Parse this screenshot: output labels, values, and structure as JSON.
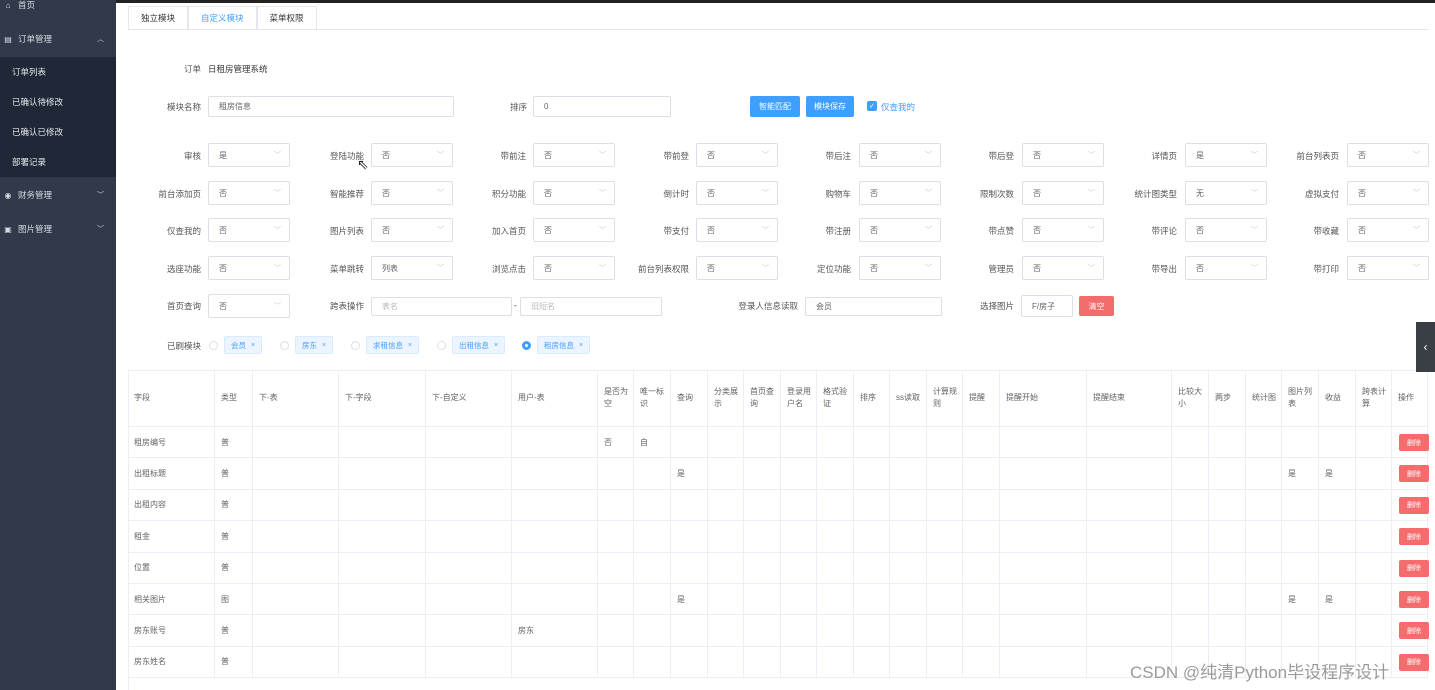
{
  "sidebar": {
    "items": [
      {
        "icon": "home-icon",
        "label": "首页"
      },
      {
        "icon": "order-icon",
        "label": "订单管理"
      },
      {
        "label": "订单列表"
      },
      {
        "label": "已确认待修改"
      },
      {
        "label": "已确认已修改"
      },
      {
        "label": "部署记录"
      },
      {
        "icon": "finance-icon",
        "label": "财务管理"
      },
      {
        "icon": "image-icon",
        "label": "图片管理"
      }
    ]
  },
  "tabs": [
    "独立模块",
    "自定义模块",
    "菜单权限"
  ],
  "order": {
    "label": "订单",
    "value": "日租房管理系统"
  },
  "module": {
    "name_label": "模块名称",
    "name_value": "租房信息",
    "sort_label": "排序",
    "sort_value": "0",
    "smart_match": "智能匹配",
    "save": "模块保存",
    "only_mine": "仅查我的"
  },
  "options": [
    {
      "label": "审核",
      "value": "是"
    },
    {
      "label": "登陆功能",
      "value": "否"
    },
    {
      "label": "带前注",
      "value": "否"
    },
    {
      "label": "带前登",
      "value": "否"
    },
    {
      "label": "带后注",
      "value": "否"
    },
    {
      "label": "带后登",
      "value": "否"
    },
    {
      "label": "详情页",
      "value": "是"
    },
    {
      "label": "前台列表页",
      "value": "否"
    },
    {
      "label": "前台添加页",
      "value": "否"
    },
    {
      "label": "智能推荐",
      "value": "否"
    },
    {
      "label": "积分功能",
      "value": "否"
    },
    {
      "label": "倒计时",
      "value": "否"
    },
    {
      "label": "购物车",
      "value": "否"
    },
    {
      "label": "限制次数",
      "value": "否"
    },
    {
      "label": "统计图类型",
      "value": "无"
    },
    {
      "label": "虚拟支付",
      "value": "否"
    },
    {
      "label": "仅查我的",
      "value": "否"
    },
    {
      "label": "图片列表",
      "value": "否"
    },
    {
      "label": "加入首页",
      "value": "否"
    },
    {
      "label": "带支付",
      "value": "否"
    },
    {
      "label": "带注册",
      "value": "否"
    },
    {
      "label": "带点赞",
      "value": "否"
    },
    {
      "label": "带评论",
      "value": "否"
    },
    {
      "label": "带收藏",
      "value": "否"
    },
    {
      "label": "选座功能",
      "value": "否"
    },
    {
      "label": "菜单跳转",
      "value": "列表"
    },
    {
      "label": "浏览点击",
      "value": "否"
    },
    {
      "label": "前台列表权限",
      "value": "否"
    },
    {
      "label": "定位功能",
      "value": "否"
    },
    {
      "label": "管理员",
      "value": "否"
    },
    {
      "label": "带导出",
      "value": "否"
    },
    {
      "label": "带打印",
      "value": "否"
    },
    {
      "label": "首页查询",
      "value": "否"
    }
  ],
  "cross": {
    "label": "跨表操作",
    "ph1": "表名",
    "sep": "-",
    "ph2": "旧短名"
  },
  "login_info": {
    "label": "登录人信息读取",
    "value": "会员"
  },
  "image_pick": {
    "label": "选择图片",
    "value": "F/房子",
    "clear": "清空"
  },
  "modules": {
    "label": "已刷模块",
    "tags": [
      "会员",
      "房东",
      "求租信息",
      "出租信息",
      "租房信息"
    ],
    "selected": 4
  },
  "table": {
    "headers": [
      "字段",
      "类型",
      "下-表",
      "下-字段",
      "下-自定义",
      "用户-表",
      "是否为空",
      "唯一标识",
      "查询",
      "分类展示",
      "首页查询",
      "登录用户名",
      "格式验证",
      "排序",
      "ss读取",
      "计算规则",
      "提醒",
      "提醒开始",
      "提醒结束",
      "比较大小",
      "两步",
      "统计图",
      "图片列表",
      "收益",
      "跨表计算",
      "操作"
    ],
    "delete_label": "删除",
    "rows": [
      {
        "field": "租房编号",
        "type": "普",
        "user_table": "",
        "nullable": "否",
        "unique": "自",
        "query": "",
        "img_list": "",
        "revenue": ""
      },
      {
        "field": "出租标题",
        "type": "普",
        "user_table": "",
        "nullable": "",
        "unique": "",
        "query": "是",
        "img_list": "是",
        "revenue": "是"
      },
      {
        "field": "出租内容",
        "type": "普",
        "user_table": "",
        "nullable": "",
        "unique": "",
        "query": "",
        "img_list": "",
        "revenue": ""
      },
      {
        "field": "租金",
        "type": "普",
        "user_table": "",
        "nullable": "",
        "unique": "",
        "query": "",
        "img_list": "",
        "revenue": ""
      },
      {
        "field": "位置",
        "type": "普",
        "user_table": "",
        "nullable": "",
        "unique": "",
        "query": "",
        "img_list": "",
        "revenue": ""
      },
      {
        "field": "相关图片",
        "type": "图",
        "user_table": "",
        "nullable": "",
        "unique": "",
        "query": "是",
        "img_list": "是",
        "revenue": "是"
      },
      {
        "field": "房东账号",
        "type": "普",
        "user_table": "房东",
        "nullable": "",
        "unique": "",
        "query": "",
        "img_list": "",
        "revenue": ""
      },
      {
        "field": "房东姓名",
        "type": "普",
        "user_table": "",
        "nullable": "",
        "unique": "",
        "query": "",
        "img_list": "",
        "revenue": ""
      }
    ]
  },
  "watermark": "CSDN @纯清Python毕设程序设计"
}
